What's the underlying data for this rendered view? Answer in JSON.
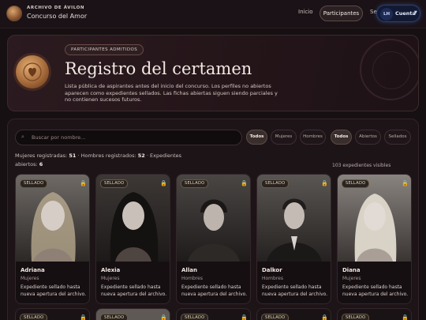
{
  "nav": {
    "brand_kicker": "ARCHIVO DE ÁVILON",
    "brand_title": "Concurso del Amor",
    "links": [
      "Inicio",
      "Participantes",
      "Se"
    ],
    "account": {
      "initials": "LH",
      "label": "Cuenta",
      "caret": "▼"
    }
  },
  "hero": {
    "badge": "PARTICIPANTES ADMITIDOS",
    "title": "Registro del certamen",
    "description": "Lista pública de aspirantes antes del inicio del concurso. Los perfiles no abiertos aparecen como expedientes sellados. Las fichas abiertas siguen siendo parciales y no contienen sucesos futuros."
  },
  "filters": {
    "search_icon": "⌕",
    "search_placeholder": "Buscar por nombre...",
    "gender_chips": [
      "Todos",
      "Mujeres",
      "Hombres"
    ],
    "status_chips": [
      "Todos",
      "Abiertos",
      "Sellados"
    ]
  },
  "stats": {
    "women_label": "Mujeres registradas:",
    "women_count": "51",
    "men_label": "Hombres registrados:",
    "men_count": "52",
    "open_label": "Expedientes abiertos:",
    "open_count": "6",
    "visible": "103 expedientes visibles"
  },
  "cards": [
    {
      "badge": "SELLADO",
      "name": "Adriana",
      "category": "Mujeres",
      "note": "Expediente sellado hasta nueva apertura del archivo."
    },
    {
      "badge": "SELLADO",
      "name": "Alexia",
      "category": "Mujeres",
      "note": "Expediente sellado hasta nueva apertura del archivo."
    },
    {
      "badge": "SELLADO",
      "name": "Allan",
      "category": "Hombres",
      "note": "Expediente sellado hasta nueva apertura del archivo."
    },
    {
      "badge": "SELLADO",
      "name": "Dalkor",
      "category": "Hombres",
      "note": "Expediente sellado hasta nueva apertura del archivo."
    },
    {
      "badge": "SELLADO",
      "name": "Diana",
      "category": "Mujeres",
      "note": "Expediente sellado hasta nueva apertura del archivo."
    }
  ],
  "next_row_badges": [
    "SELLADO",
    "SELLADO",
    "SELLADO",
    "SELLADO",
    "SELLADO"
  ],
  "icons": {
    "lock": "🔒"
  },
  "colors": {
    "accent_gold": "#e0b44a",
    "account_glow": "#2b3f73"
  }
}
